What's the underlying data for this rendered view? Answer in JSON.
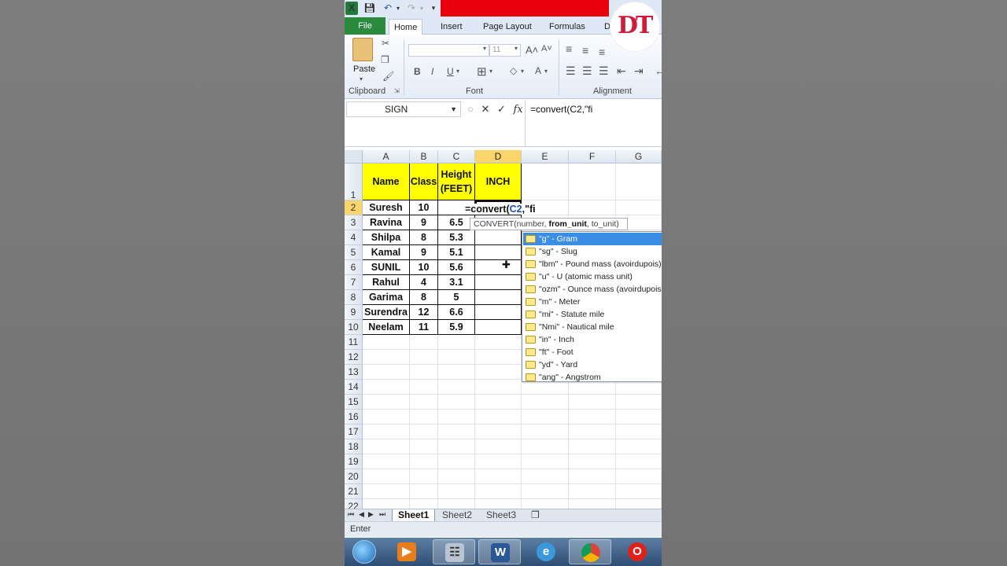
{
  "qat": {
    "app_icon": "X"
  },
  "tabs": [
    "File",
    "Home",
    "Insert",
    "Page Layout",
    "Formulas",
    "D"
  ],
  "ribbon": {
    "paste_label": "Paste",
    "font_size": "11",
    "groups": [
      "Clipboard",
      "Font",
      "Alignment"
    ]
  },
  "name_box": "SIGN",
  "formula": "=convert(C2,\"fi",
  "columns": [
    "A",
    "B",
    "C",
    "D",
    "E",
    "F",
    "G"
  ],
  "rows": [
    "1",
    "2",
    "3",
    "4",
    "5",
    "6",
    "7",
    "8",
    "9",
    "10",
    "11",
    "12",
    "13",
    "14",
    "15",
    "16",
    "17",
    "18",
    "19",
    "20",
    "21",
    "22"
  ],
  "headers": {
    "name": "Name",
    "class": "Class",
    "height": "Height\n(FEET)",
    "inch": "INCH"
  },
  "data_rows": [
    {
      "name": "Suresh",
      "class": "10",
      "height": ""
    },
    {
      "name": "Ravina",
      "class": "9",
      "height": "6.5"
    },
    {
      "name": "Shilpa",
      "class": "8",
      "height": "5.3"
    },
    {
      "name": "Kamal",
      "class": "9",
      "height": "5.1"
    },
    {
      "name": "SUNIL",
      "class": "10",
      "height": "5.6"
    },
    {
      "name": "Rahul",
      "class": "4",
      "height": "3.1"
    },
    {
      "name": "Garima",
      "class": "8",
      "height": "5"
    },
    {
      "name": "Surendra",
      "class": "12",
      "height": "6.6"
    },
    {
      "name": "Neelam",
      "class": "11",
      "height": "5.9"
    }
  ],
  "edit": {
    "prefix": "=convert(",
    "ref": "C2",
    "suffix": ",\"fi"
  },
  "tooltip": {
    "a": "CONVERT(number, ",
    "b": "from_unit",
    "c": ", to_unit)"
  },
  "dropdown": [
    "\"g\" - Gram",
    "\"sg\" - Slug",
    "\"lbm\" - Pound mass (avoirdupois)",
    "\"u\" - U (atomic mass unit)",
    "\"ozm\" - Ounce mass (avoirdupois)",
    "\"m\" - Meter",
    "\"mi\" - Statute mile",
    "\"Nmi\" - Nautical mile",
    "\"in\" - Inch",
    "\"ft\" - Foot",
    "\"yd\" - Yard",
    "\"ang\" - Angstrom"
  ],
  "sheets": [
    "Sheet1",
    "Sheet2",
    "Sheet3"
  ],
  "status": "Enter",
  "logo_text": "DT",
  "taskbar": [
    "start-icon",
    "media-player-icon",
    "calculator-icon",
    "word-icon",
    "internet-explorer-icon",
    "chrome-icon",
    "opera-icon"
  ],
  "colors": {
    "header_fill": "#ffff00",
    "selection": "#3a8ee6",
    "file_tab": "#2a8a3e"
  }
}
